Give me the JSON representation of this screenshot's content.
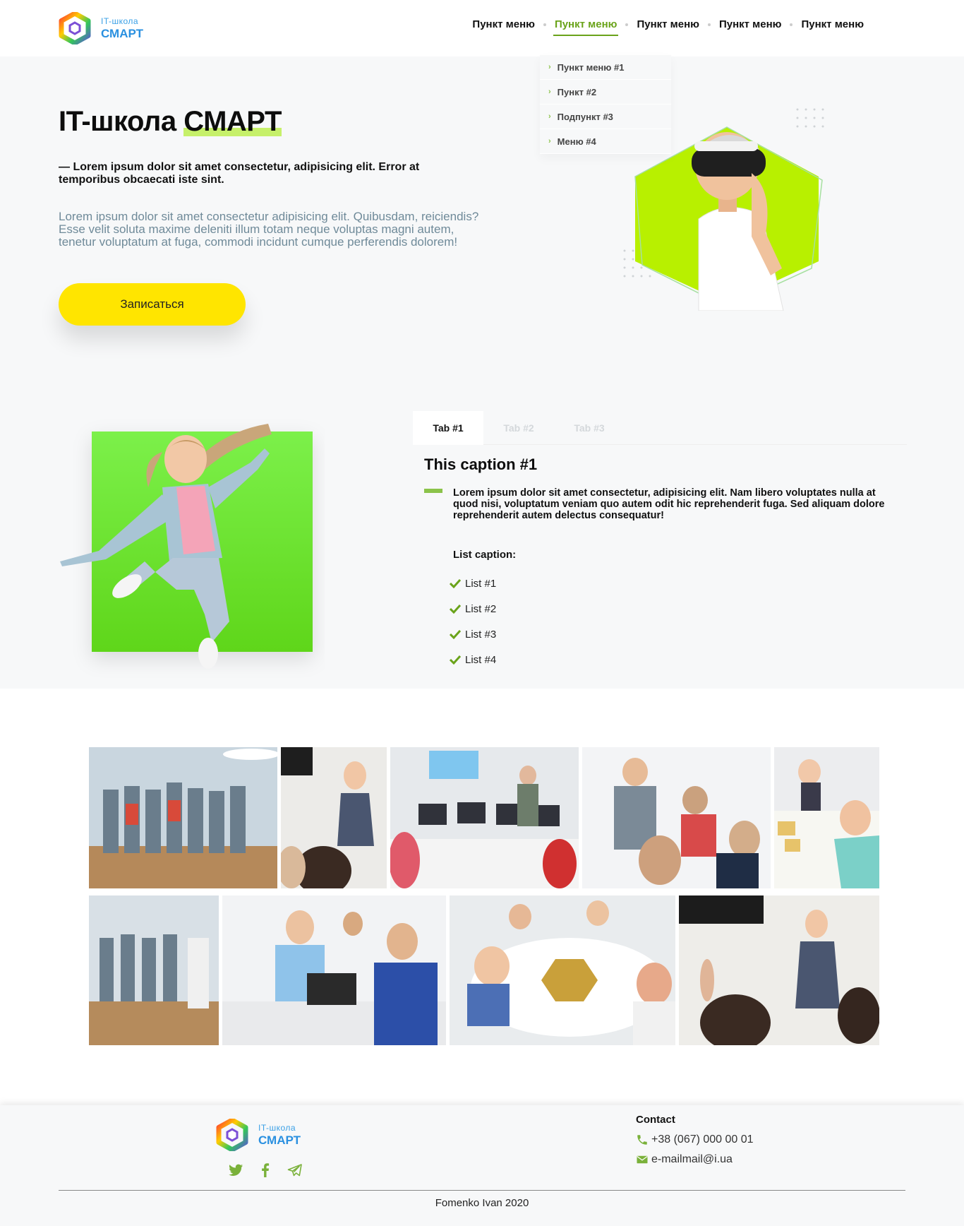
{
  "brand": {
    "small": "IT-школа",
    "big": "СМАРТ"
  },
  "nav": [
    {
      "label": "Пункт меню"
    },
    {
      "label": "Пункт меню"
    },
    {
      "label": "Пункт меню"
    },
    {
      "label": "Пункт меню"
    },
    {
      "label": "Пункт меню"
    }
  ],
  "dropdown": [
    "Пункт меню #1",
    "Пункт #2",
    "Подпункт #3",
    "Меню #4"
  ],
  "hero": {
    "title_plain": "IT-школа",
    "title_highlight": "СМАРТ",
    "subtitle": "— Lorem ipsum dolor sit amet consectetur, adipisicing elit. Error at temporibus obcaecati iste sint.",
    "text": "Lorem ipsum dolor sit amet consectetur adipisicing elit. Quibusdam, reiciendis? Esse velit soluta maxime deleniti illum totam neque voluptas magni autem, tenetur voluptatum at fuga, commodi incidunt cumque perferendis dolorem!",
    "cta": "Записаться"
  },
  "tabs": [
    "Tab #1",
    "Tab #2",
    "Tab #3"
  ],
  "tab_content": {
    "caption": "This caption #1",
    "text": "Lorem ipsum dolor sit amet consectetur, adipisicing elit. Nam libero voluptates nulla at quod nisi, voluptatum veniam quo autem odit hic reprehenderit fuga. Sed aliquam dolore reprehenderit autem delectus consequatur!",
    "list_caption": "List caption:",
    "list": [
      "List #1",
      "List #2",
      "List #3",
      "List #4"
    ]
  },
  "footer": {
    "brand_small": "IT-школа",
    "brand_big": "СМАРТ",
    "contact_title": "Contact",
    "phone": "+38 (067) 000 00 01",
    "email": "e-mailmail@i.ua",
    "copyright": "Fomenko Ivan 2020"
  },
  "colors": {
    "accent": "#8bc34a",
    "cta": "#ffe500",
    "brand_blue": "#2a90e0",
    "muted_text": "#6f8a99"
  },
  "icons": [
    "logo-hex-icon",
    "chevron-right-icon",
    "check-icon",
    "twitter-icon",
    "facebook-icon",
    "telegram-icon",
    "phone-icon",
    "mail-icon"
  ]
}
